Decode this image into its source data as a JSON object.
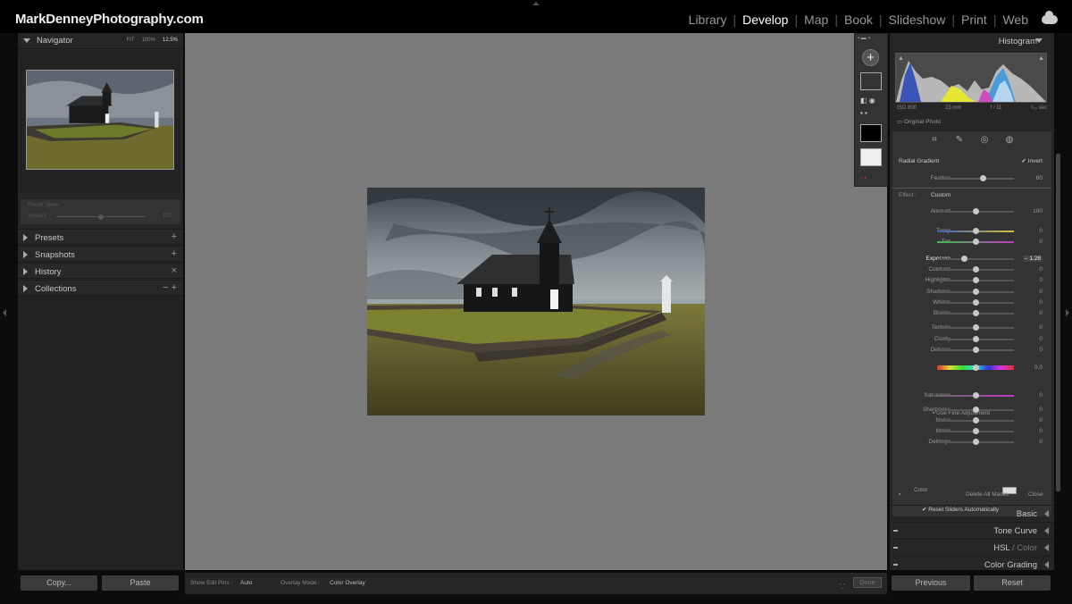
{
  "brand": "MarkDenneyPhotography.com",
  "modules": [
    "Library",
    "Develop",
    "Map",
    "Book",
    "Slideshow",
    "Print",
    "Web"
  ],
  "active_module": "Develop",
  "left": {
    "navigator": {
      "title": "Navigator",
      "zoom": [
        "FIT",
        "100%",
        "12.5%"
      ]
    },
    "feather_panel": {
      "title": "Preset: None",
      "slider_label": "Amount",
      "value": "100"
    },
    "panels": [
      {
        "label": "Presets",
        "action": "+"
      },
      {
        "label": "Snapshots",
        "action": "+"
      },
      {
        "label": "History",
        "action": "×"
      },
      {
        "label": "Collections",
        "action": "− +"
      }
    ],
    "copy_label": "Copy...",
    "paste_label": "Paste"
  },
  "toolbar": {
    "show_edit_pins_label": "Show Edit Pins :",
    "show_edit_pins_value": "Auto",
    "overlay_mode_label": "Overlay Mode :",
    "overlay_mode_value": "Color Overlay",
    "done_label": "Done"
  },
  "right": {
    "histogram": {
      "title": "Histogram",
      "iso": "ISO 800",
      "focal": "23 mm",
      "aperture": "f / 11",
      "shutter": "¹⁄₁₀ sec",
      "original_photo": "Original Photo"
    },
    "mask": {
      "name": "Radial Gradient",
      "invert_label": "Invert",
      "feather": {
        "label": "Feather",
        "value": "60",
        "pos": 0.6
      },
      "effect_label": "Effect :",
      "effect_value": "Custom",
      "amount": {
        "label": "Amount",
        "value": "100",
        "pos": 0.5
      },
      "sliders": [
        {
          "label": "Temp",
          "value": "0",
          "pos": 0.5
        },
        {
          "label": "Tint",
          "value": "0",
          "pos": 0.5
        },
        {
          "label": "Exposure",
          "value": "– 1.28",
          "pos": 0.36
        },
        {
          "label": "Contrast",
          "value": "0",
          "pos": 0.5
        },
        {
          "label": "Highlights",
          "value": "0",
          "pos": 0.5
        },
        {
          "label": "Shadows",
          "value": "0",
          "pos": 0.5
        },
        {
          "label": "Whites",
          "value": "0",
          "pos": 0.5
        },
        {
          "label": "Blacks",
          "value": "0",
          "pos": 0.5
        },
        {
          "label": "Texture",
          "value": "0",
          "pos": 0.5
        },
        {
          "label": "Clarity",
          "value": "0",
          "pos": 0.5
        },
        {
          "label": "Dehaze",
          "value": "0",
          "pos": 0.5
        },
        {
          "label": "Hue",
          "value": "0.0",
          "pos": 0.5
        },
        {
          "label": "Saturation",
          "value": "0",
          "pos": 0.5
        },
        {
          "label": "Sharpness",
          "value": "0",
          "pos": 0.5
        },
        {
          "label": "Noise",
          "value": "0",
          "pos": 0.5
        },
        {
          "label": "Moiré",
          "value": "0",
          "pos": 0.5
        },
        {
          "label": "Defringe",
          "value": "0",
          "pos": 0.5
        }
      ],
      "fine_adjustment_label": "Use Fine Adjustment",
      "color_label": "Color",
      "reset_sliders_label": "Reset Sliders Automatically",
      "delete_all_label": "Delete All Masks",
      "close_label": "Close"
    },
    "panels": [
      {
        "label": "Basic"
      },
      {
        "label": "Tone Curve"
      },
      {
        "label": "HSL",
        "dim": "/ Color"
      },
      {
        "label": "Color Grading"
      }
    ],
    "previous_label": "Previous",
    "reset_label": "Reset"
  }
}
